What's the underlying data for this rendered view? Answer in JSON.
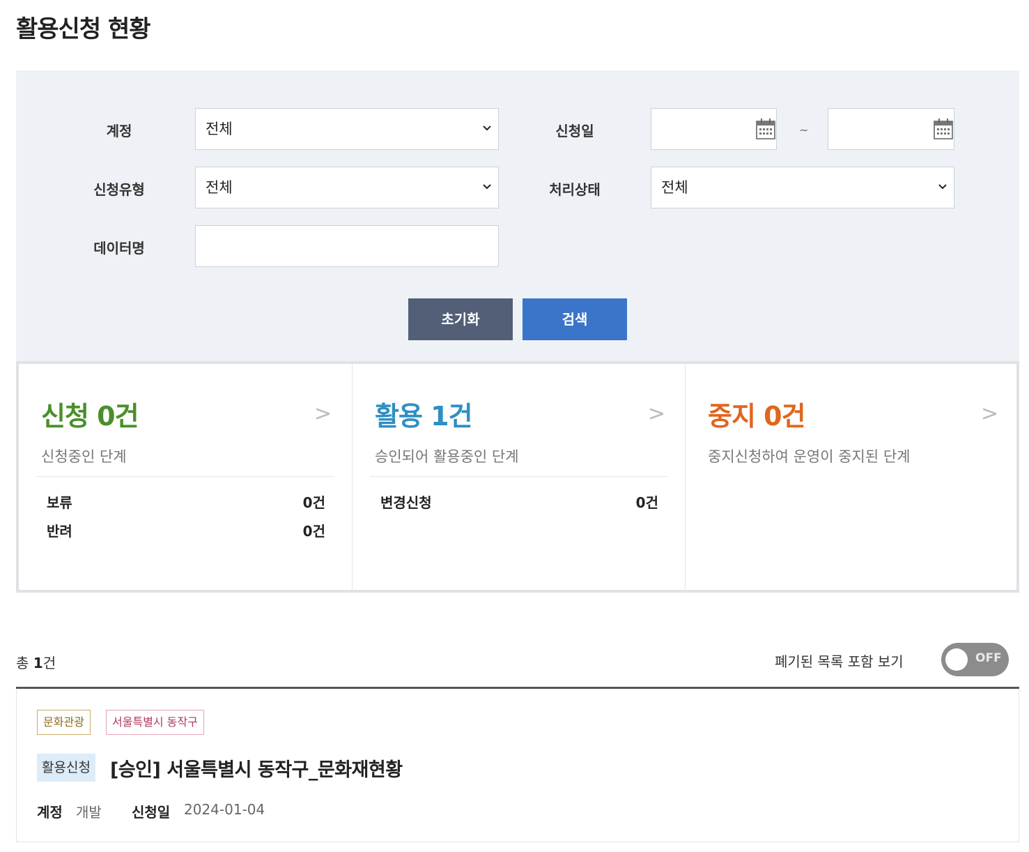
{
  "page": {
    "title": "활용신청 현황"
  },
  "search": {
    "account_label": "계정",
    "account_value": "전체",
    "apply_date_label": "신청일",
    "date_separator": "~",
    "apply_type_label": "신청유형",
    "apply_type_value": "전체",
    "status_label": "처리상태",
    "status_value": "전체",
    "data_name_label": "데이터명",
    "data_name_value": "",
    "reset_label": "초기화",
    "search_label": "검색"
  },
  "stats": [
    {
      "title": "신청 0건",
      "color": "#4a8f2a",
      "description": "신청중인 단계",
      "arrow": ">",
      "rows": [
        {
          "label": "보류",
          "value": "0건"
        },
        {
          "label": "반려",
          "value": "0건"
        }
      ]
    },
    {
      "title": "활용 1건",
      "color": "#2e8fc2",
      "description": "승인되어 활용중인 단계",
      "arrow": ">",
      "rows": [
        {
          "label": "변경신청",
          "value": "0건"
        }
      ]
    },
    {
      "title": "중지 0건",
      "color": "#e0661e",
      "description": "중지신청하여 운영이 중지된 단계",
      "arrow": ">",
      "rows": []
    }
  ],
  "list": {
    "total_prefix": "총",
    "total_count": "1",
    "total_suffix": "건",
    "toggle_label": "폐기된 목록 포함 보기",
    "toggle_state": "OFF",
    "items": [
      {
        "category_tag": "문화관광",
        "org_tag": "서울특별시 동작구",
        "type_badge": "활용신청",
        "title": "[승인] 서울특별시 동작구_문화재현황",
        "account_label": "계정",
        "account_value": "개발",
        "date_label": "신청일",
        "date_value": "2024-01-04"
      }
    ]
  },
  "icons": {
    "select_arrow": "chevron-down-icon",
    "date_picker": "calendar-icon"
  }
}
